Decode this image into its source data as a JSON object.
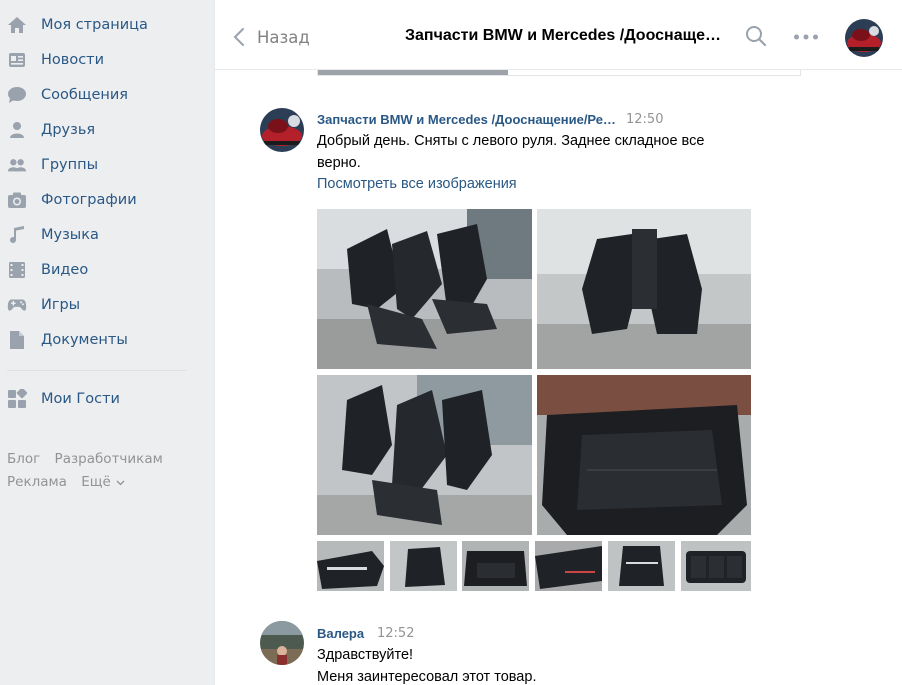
{
  "sidebar": {
    "items": [
      {
        "label": "Моя страница",
        "icon": "home-icon"
      },
      {
        "label": "Новости",
        "icon": "news-icon"
      },
      {
        "label": "Сообщения",
        "icon": "messages-icon"
      },
      {
        "label": "Друзья",
        "icon": "friends-icon"
      },
      {
        "label": "Группы",
        "icon": "groups-icon"
      },
      {
        "label": "Фотографии",
        "icon": "camera-icon"
      },
      {
        "label": "Музыка",
        "icon": "music-icon"
      },
      {
        "label": "Видео",
        "icon": "video-icon"
      },
      {
        "label": "Игры",
        "icon": "games-icon"
      },
      {
        "label": "Документы",
        "icon": "documents-icon"
      }
    ],
    "apps": [
      {
        "label": "Мои Гости",
        "icon": "apps-icon"
      }
    ],
    "footer": {
      "blog": "Блог",
      "developers": "Разработчикам",
      "ads": "Реклама",
      "more": "Ещё"
    }
  },
  "header": {
    "back_label": "Назад",
    "title": "Запчасти BMW и Mercedes /Дооснащение/Ремонт"
  },
  "messages": [
    {
      "author": "Запчасти BMW и Mercedes /Дооснащение/Ремонт",
      "time": "12:50",
      "text_line1": "Добрый день. Сняты с левого руля. Заднее складное все",
      "text_line2": "верно.",
      "link": "Посмотреть все изображения"
    },
    {
      "author": "Валера",
      "time": "12:52",
      "text_line1": "Здравствуйте!",
      "text_line2": "Меня заинтересовал этот товар."
    }
  ],
  "colors": {
    "link": "#2a5885",
    "muted": "#939393",
    "sidebar_bg": "#edeef0",
    "icon": "#99a2ad"
  }
}
